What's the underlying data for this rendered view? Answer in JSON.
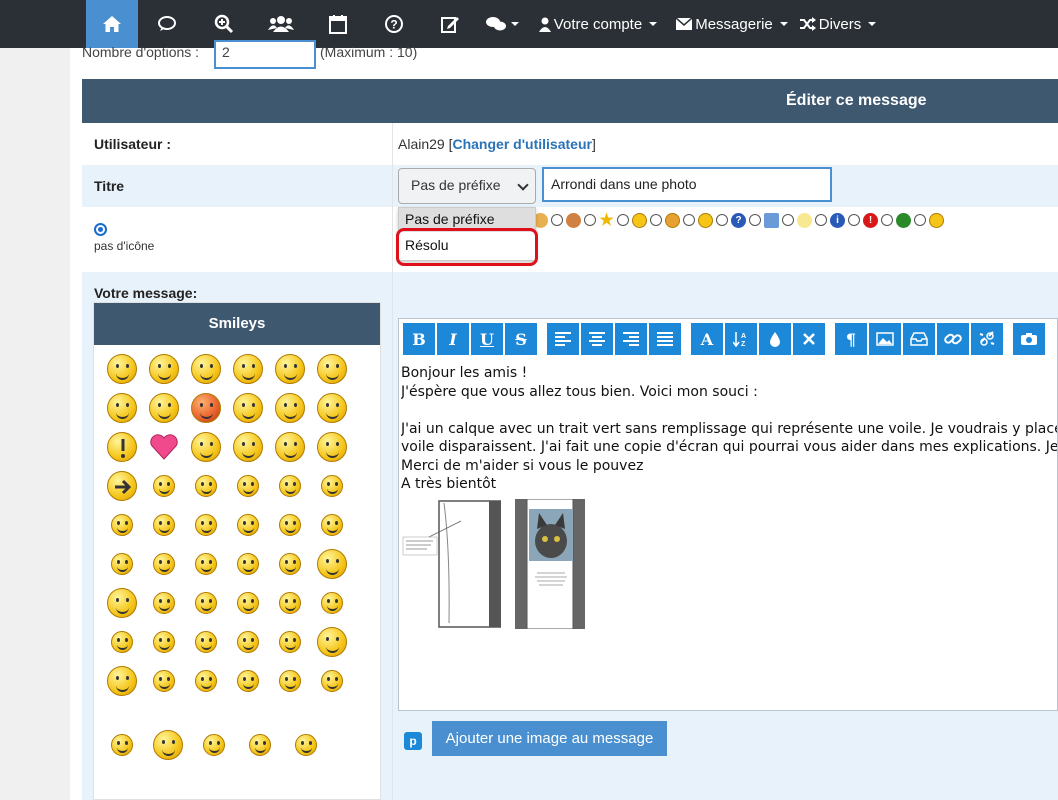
{
  "nav": {
    "account_label": "Votre compte",
    "messaging_label": "Messagerie",
    "misc_label": "Divers"
  },
  "options": {
    "count_label": "Nombre d'options :",
    "count_value": "2",
    "max_label": "(Maximum : 10)"
  },
  "edit": {
    "header": "Éditer ce message",
    "user_label": "Utilisateur :",
    "user_name": "Alain29",
    "change_user_link": "Changer d'utilisateur",
    "title_label": "Titre",
    "prefix_selected": "Pas de préfixe",
    "title_value": "Arrondi dans une photo",
    "no_icon_label": "pas d'icône",
    "prefix_options": [
      "Pas de préfixe",
      "Résolu"
    ]
  },
  "message": {
    "label": "Votre message:",
    "smileys_header": "Smileys",
    "lines": [
      "Bonjour les amis !",
      "J'éspère que vous allez tous bien. Voici mon souci :",
      "",
      "J'ai un calque avec un trait vert sans remplissage qui représente une voile. Je voudrais y placer un",
      "voile disparaissent. J'ai fait une copie d'écran qui pourrai vous aider dans mes explications. Je pens",
      "Merci de m'aider si vous le pouvez",
      "A très bientôt"
    ],
    "add_image_button": "Ajouter une image au message"
  },
  "colors": {
    "nav_bg": "#2a3036",
    "nav_active": "#4a90d0",
    "header_bg": "#3e5870",
    "toolbar_btn": "#1e88d8",
    "highlight_outline": "#e0101a"
  }
}
